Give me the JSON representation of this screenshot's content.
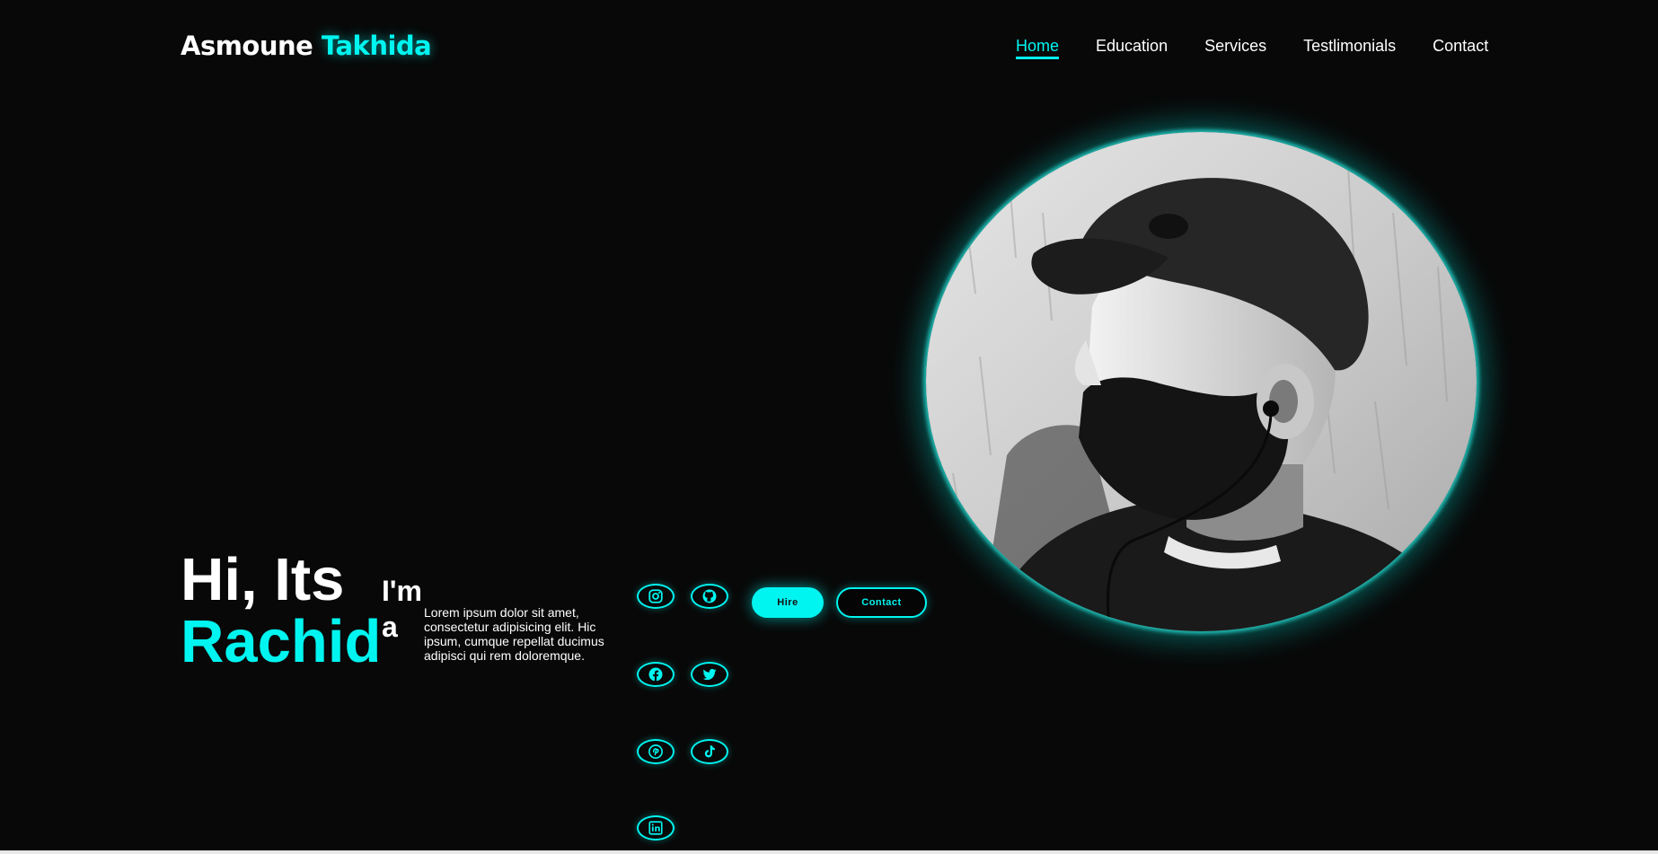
{
  "header": {
    "logo_first": "Asmoune",
    "logo_second": "Takhida",
    "nav": [
      {
        "label": "Home",
        "active": true
      },
      {
        "label": "Education",
        "active": false
      },
      {
        "label": "Services",
        "active": false
      },
      {
        "label": "Testlimonials",
        "active": false
      },
      {
        "label": "Contact",
        "active": false
      }
    ]
  },
  "hero": {
    "greeting": "Hi, Its",
    "name": "Rachid",
    "im_text": "I'm",
    "typed_letter": "a",
    "description": "Lorem ipsum dolor sit amet, consectetur adipisicing elit. Hic ipsum, cumque repellat ducimus adipisci qui rem doloremque."
  },
  "social_icons": [
    "instagram-icon",
    "github-icon",
    "facebook-icon",
    "twitter-icon",
    "pinterest-icon",
    "tiktok-icon",
    "linkedin-icon"
  ],
  "buttons": {
    "hire": "Hire",
    "contact": "Contact"
  },
  "colors": {
    "accent": "#00f5f0",
    "background": "#080808",
    "text": "#ffffff"
  }
}
